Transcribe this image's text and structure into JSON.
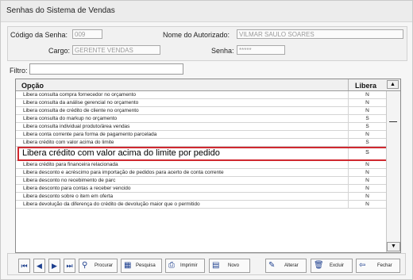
{
  "window": {
    "title": "Senhas do Sistema de Vendas"
  },
  "form": {
    "codigo_label": "Código da Senha:",
    "codigo_value": "009",
    "autorizado_label": "Nome do Autorizado:",
    "autorizado_value": "VILMAR SAULO SOARES",
    "cargo_label": "Cargo:",
    "cargo_value": "GERENTE VENDAS",
    "senha_label": "Senha:",
    "senha_value": "*****"
  },
  "filter": {
    "label": "Filtro:",
    "value": ""
  },
  "grid": {
    "col_option": "Opção",
    "col_libera": "Libera",
    "rows": [
      {
        "op": "Libera consulta compra fornecedor no orçamento",
        "lb": "N"
      },
      {
        "op": "Libera consulta da análise gerencial no orçamento",
        "lb": "N"
      },
      {
        "op": "Libera consulta de crédito de cliente no orçamento",
        "lb": "N"
      },
      {
        "op": "Libera consulta do markup no orçamento",
        "lb": "S"
      },
      {
        "op": "Libera consulta individual produto/área vendas",
        "lb": "S"
      },
      {
        "op": "Libera conta corrente para forma de pagamento parcelada",
        "lb": "N"
      },
      {
        "op": "Libera crédito com valor acima do limite",
        "lb": "S"
      },
      {
        "op": "Libera crédito com valor acima do limite por pedido",
        "lb": "S"
      },
      {
        "op": "Libera crédito para financeira relacionada",
        "lb": "N"
      },
      {
        "op": "Libera desconto e acréscimo para importação de pedidos para acerto de conta corrente",
        "lb": "N"
      },
      {
        "op": "Libera desconto no recebimento de parc",
        "lb": "N"
      },
      {
        "op": "Libera desconto para contas a receber vencido",
        "lb": "N"
      },
      {
        "op": "Libera desconto sobre o item em oferta",
        "lb": "N"
      },
      {
        "op": "Libera devolução da diferença do crédito de devolução maior que o permitido",
        "lb": "N"
      }
    ],
    "selected_index": 7
  },
  "toolbar": {
    "procurar": "Procurar",
    "pesquisa": "Pesquisa",
    "imprimir": "Imprimir",
    "novo": "Novo",
    "alterar": "Alterar",
    "excluir": "Excluir",
    "fechar": "Fechar"
  },
  "colors": {
    "highlight": "#d0282f",
    "icon": "#1d3f8e"
  }
}
